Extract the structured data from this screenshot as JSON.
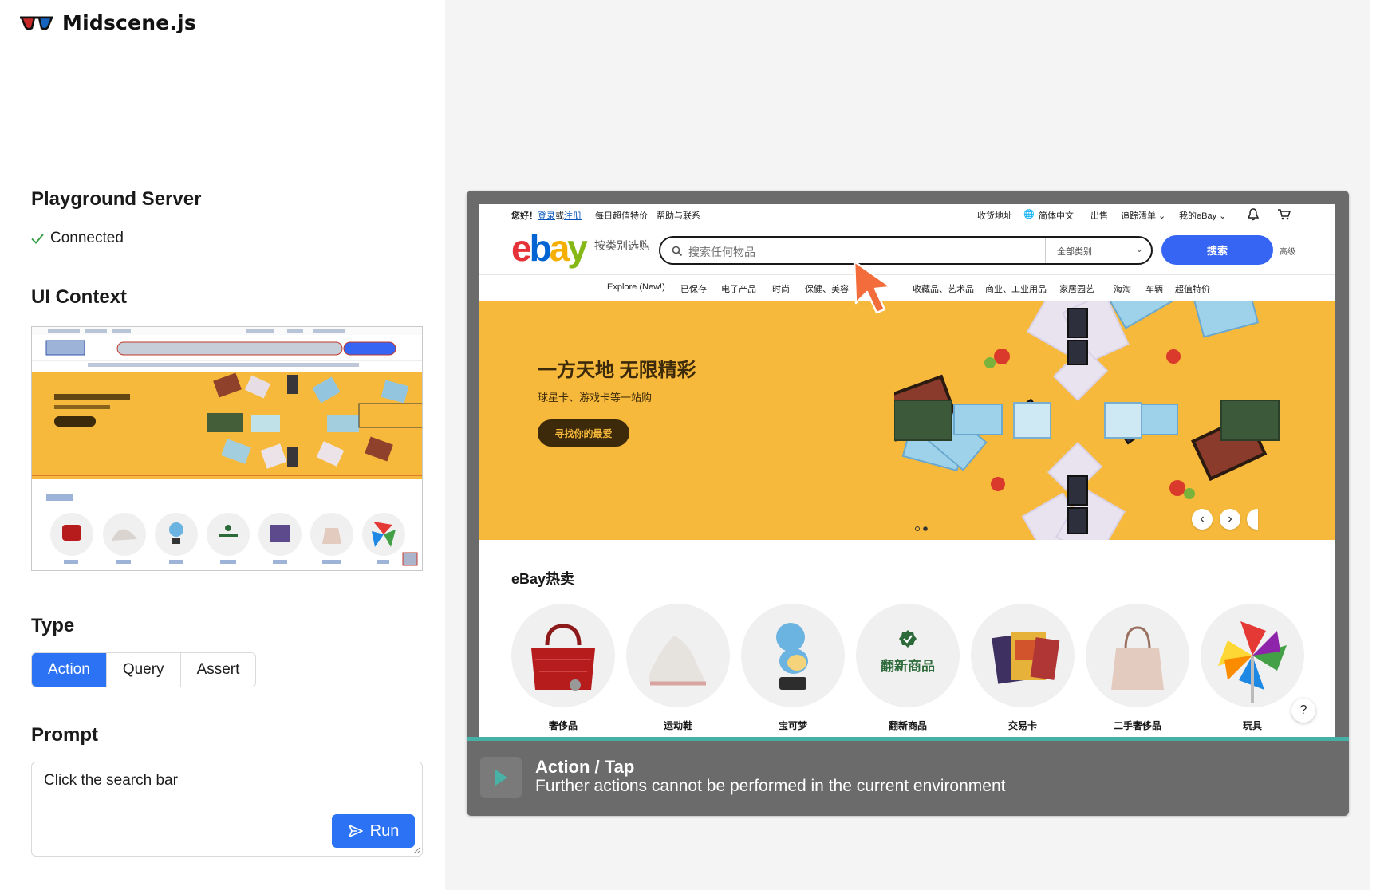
{
  "app": {
    "name": "Midscene.js"
  },
  "server": {
    "title": "Playground Server",
    "status": "Connected"
  },
  "context": {
    "title": "UI Context"
  },
  "type": {
    "title": "Type",
    "options": [
      "Action",
      "Query",
      "Assert"
    ],
    "selected": "Action"
  },
  "prompt": {
    "title": "Prompt",
    "value": "Click the search bar",
    "run_label": "Run"
  },
  "result": {
    "title": "Action / Tap",
    "message": "Further actions cannot be performed in the current environment"
  },
  "colors": {
    "accent": "#2b72f4",
    "progress": "#46b0a6",
    "device": "#6b6b6b"
  },
  "ebay": {
    "greeting": "您好！",
    "login": "登录",
    "or": "或",
    "register": "注册",
    "deals": "每日超值特价",
    "help": "帮助与联系",
    "ship_to": "收货地址",
    "language": "简体中文",
    "sell": "出售",
    "watchlist": "追踪清单",
    "my_ebay": "我的eBay",
    "shop_by_category": "按类别选购",
    "search_placeholder": "搜索任何物品",
    "all_categories": "全部类别",
    "search_button": "搜索",
    "advanced": "高级",
    "nav": [
      "Explore (New!)",
      "已保存",
      "电子产品",
      "时尚",
      "保健、美容",
      "收藏品、艺术品",
      "商业、工业用品",
      "家居园艺",
      "海淘",
      "车辆",
      "超值特价"
    ],
    "hero_title": "一方天地 无限精彩",
    "hero_sub": "球星卡、游戏卡等一站购",
    "hero_button": "寻找你的最爱",
    "hot_title": "eBay热卖",
    "categories": [
      "奢侈品",
      "运动鞋",
      "宝可梦",
      "翻新商品",
      "交易卡",
      "二手奢侈品",
      "玩具"
    ],
    "refurb_badge": "翻新商品",
    "help_icon": "?"
  }
}
